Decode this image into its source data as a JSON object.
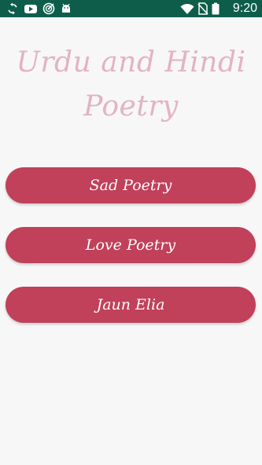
{
  "status_bar": {
    "time": "9:20",
    "icons": [
      "sync-icon",
      "youtube-icon",
      "radar-icon",
      "android-icon",
      "wifi-icon",
      "no-sim-icon",
      "battery-icon"
    ]
  },
  "app": {
    "title": "Urdu and Hindi Poetry"
  },
  "buttons": [
    {
      "label": "Sad Poetry"
    },
    {
      "label": "Love Poetry"
    },
    {
      "label": "Jaun Elia"
    }
  ],
  "colors": {
    "status_bar_bg": "#0d5d4a",
    "title": "#e3b2c5",
    "button_bg": "#c1405a",
    "background": "#f7f7f7"
  }
}
